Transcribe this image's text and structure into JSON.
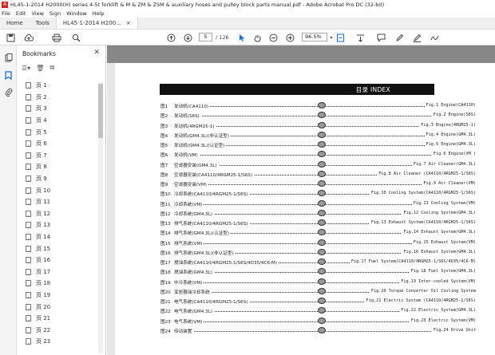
{
  "window": {
    "title": "HL45-1-2014 H2000(H) series 4-5t forklift & M & ZM & ZSM & auxiliary hoses and pulley block parts manual.pdf - Adobe Acrobat Pro DC (32-bit)"
  },
  "menu": [
    "File",
    "Edit",
    "View",
    "Sign",
    "Window",
    "Help"
  ],
  "tabs": {
    "home": "Home",
    "tools": "Tools",
    "document": "HL45-1-2014 H200...",
    "close": "×"
  },
  "toolbar": {
    "page_current": "5",
    "page_total": "/ 126",
    "zoom": "96.5%"
  },
  "bookmarks": {
    "title": "Bookmarks",
    "items": [
      "页 1",
      "页 2",
      "页 3",
      "页 4",
      "页 5",
      "页 6",
      "页 7",
      "页 8",
      "页 9",
      "页 10",
      "页 11",
      "页 12",
      "页 13",
      "页 14",
      "页 15",
      "页 16",
      "页 17",
      "页 18",
      "页 19",
      "页 20",
      "页 21",
      "页 22",
      "页 23"
    ]
  },
  "document": {
    "heading": "目录 INDEX",
    "rows": [
      {
        "no": "图1",
        "cn": "发动机(CA4110)",
        "en": "Fig.1 Engine(CA4110)"
      },
      {
        "no": "图2",
        "cn": "发动机(S6S)",
        "en": "Fig.2 Engine(S6S)"
      },
      {
        "no": "图3",
        "cn": "发动机(4RGM25-1)",
        "en": "Fig.3 Engine(4RGM25-1)"
      },
      {
        "no": "图4",
        "cn": "发动机(GM4.3L)(非认证型)",
        "en": "Fig.4 Engine(GM4.3L)"
      },
      {
        "no": "图5",
        "cn": "发动机(GM4.3L)(认证型)",
        "en": "Fig.5 Engine(GM4.3L)"
      },
      {
        "no": "图6",
        "cn": "发动机(VM)",
        "en": "Fig.6 Engine(VM )"
      },
      {
        "no": "图7",
        "cn": "空滤器安装(GM4.3L)",
        "en": "Fig.7 Air Cleaner(GM4.3L)"
      },
      {
        "no": "图8",
        "cn": "空滤器安装(CA4110/4RGM25-1/S6S)",
        "en": "Fig.8 Air Cleaner (CA4110/4RGM25-1/S6S)"
      },
      {
        "no": "图9",
        "cn": "空滤器安装(VM)",
        "en": "Fig.9 Air Cleaner(VM)"
      },
      {
        "no": "图10",
        "cn": "冷却系统(CA4110/4RGM25-1/S6S)",
        "en": "Fig.10 Cooling System(CA4110/4RGM25-1/S6S)"
      },
      {
        "no": "图11",
        "cn": "冷却系统(VM)",
        "en": "Fig.11 Cooling System(VM)"
      },
      {
        "no": "图12",
        "cn": "冷却系统(GM4.3L)",
        "en": "Fig.12 Cooling System(GM4.3L)"
      },
      {
        "no": "图13",
        "cn": "排气系统(CA4110/4RGM25-1/S6S)",
        "en": "Fig.13 Exhaust System(CA4110/4RGM25-1/S6S)"
      },
      {
        "no": "图14",
        "cn": "排气系统(GM4.3L)(认证型)",
        "en": "Fig.14 Exhaust System(GM4.3L)"
      },
      {
        "no": "图15",
        "cn": "排气系统(VM)",
        "en": "Fig.15 Exhaust System(VM)"
      },
      {
        "no": "图16",
        "cn": "排气系统(GM4.3L)(非认证型)",
        "en": "Fig.16 Exhaust System(GM4.3L)"
      },
      {
        "no": "图17",
        "cn": "燃油系统(CA4110/4RGM25-1/S6S/4D35/4C6-M)",
        "en": "Fig.17 Fuel System(CA4110/4RGM25-1/S6S/4D35/4C6-M)"
      },
      {
        "no": "图18",
        "cn": "燃油系统(GM4.3L)",
        "en": "Fig.18 Fuel System(GM4.3L)"
      },
      {
        "no": "图19",
        "cn": "中冷系统(VM)",
        "en": "Fig.19 Inter-cooled System(VM)"
      },
      {
        "no": "图20",
        "cn": "变矩器油冷却系统",
        "en": "Fig.20 Torque Converter Oil Cooling System"
      },
      {
        "no": "图21",
        "cn": "电气系统(CA4110/4RGM25-1/S6S)",
        "en": "Fig.21 Electric System (CA4110/4RGM25-1/S6S)"
      },
      {
        "no": "图22",
        "cn": "电气系统(GM4.3L)",
        "en": "Fig.22 Electric System(GM4.3L)"
      },
      {
        "no": "图23",
        "cn": "电气系统(VM)",
        "en": "Fig.23 Electric System(VM)"
      },
      {
        "no": "图24",
        "cn": "传动装置",
        "en": "Fig.24 Drive Unit"
      }
    ]
  }
}
